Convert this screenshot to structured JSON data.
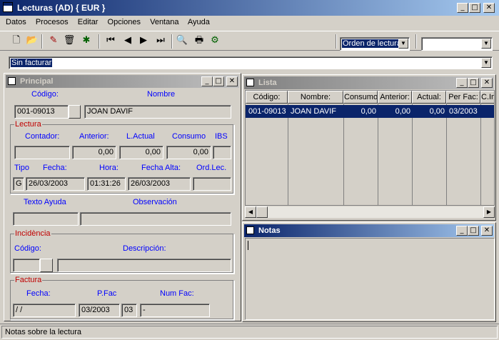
{
  "window": {
    "title": "Lecturas (AD) { EUR }"
  },
  "menu": [
    "Datos",
    "Procesos",
    "Editar",
    "Opciones",
    "Ventana",
    "Ayuda"
  ],
  "toolbar": {
    "order_select": "Orden de lectura",
    "second_select": ""
  },
  "filter": {
    "value": "Sin facturar"
  },
  "principal": {
    "title": "Principal",
    "codigo_label": "Código:",
    "nombre_label": "Nombre",
    "codigo": "001-09013",
    "nombre": "JOAN DAVIF",
    "lectura": {
      "group": "Lectura",
      "contador_label": "Contador:",
      "anterior_label": "Anterior:",
      "lactual_label": "L.Actual",
      "consumo_label": "Consumo",
      "ibs_label": "IBS",
      "contador": "",
      "anterior": "0,00",
      "lactual": "0,00",
      "consumo": "0,00",
      "ibs": "",
      "tipo_label": "Tipo",
      "fecha_label": "Fecha:",
      "hora_label": "Hora:",
      "fecha_alta_label": "Fecha Alta:",
      "ordlec_label": "Ord.Lec.",
      "tipo": "G",
      "fecha": "26/03/2003",
      "hora": "01:31:26",
      "fecha_alta": "26/03/2003",
      "ordlec": ""
    },
    "texto_ayuda_label": "Texto Ayuda",
    "observacion_label": "Observación",
    "incidencia": {
      "group": "Incidència",
      "codigo_label": "Código:",
      "descripcion_label": "Descripción:"
    },
    "factura": {
      "group": "Factura",
      "fecha_label": "Fecha:",
      "pfac_label": "P.Fac",
      "numfac_label": "Num Fac:",
      "fecha": " /  /",
      "pfac": "03/2003",
      "pfac2": "03",
      "numfac": " -"
    }
  },
  "lista": {
    "title": "Lista",
    "columns": [
      "Código:",
      "Nombre:",
      "Consumo",
      "Anterior:",
      "Actual:",
      "Per Fac:",
      "C.Inc"
    ],
    "rows": [
      [
        "001-09013",
        "JOAN DAVIF",
        "0,00",
        "0,00",
        "0,00",
        "03/2003",
        ""
      ]
    ]
  },
  "notas": {
    "title": "Notas"
  },
  "status": {
    "text": "Notas sobre la lectura"
  }
}
